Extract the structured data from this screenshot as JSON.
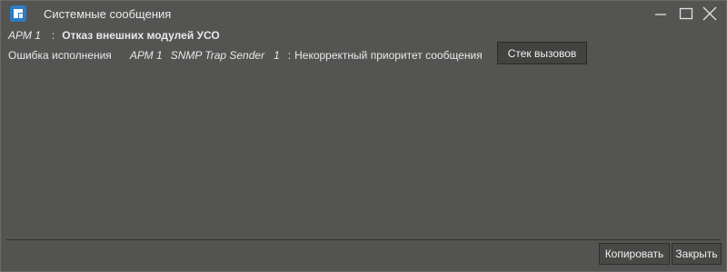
{
  "window": {
    "title": "Системные сообщения",
    "accent_color": "#2c7cc4"
  },
  "message": {
    "source": "АРМ 1",
    "separator": ":",
    "header_text": "Отказ внешних модулей УСО",
    "error_type": "Ошибка исполнения",
    "error_source": "АРМ 1",
    "error_module": "SNMP Trap Sender",
    "error_number": "1",
    "error_separator": ":",
    "error_text": "Некорректный приоритет сообщения",
    "stack_button_label": "Стек вызовов"
  },
  "footer": {
    "copy_label": "Копировать",
    "close_label": "Закрыть"
  }
}
